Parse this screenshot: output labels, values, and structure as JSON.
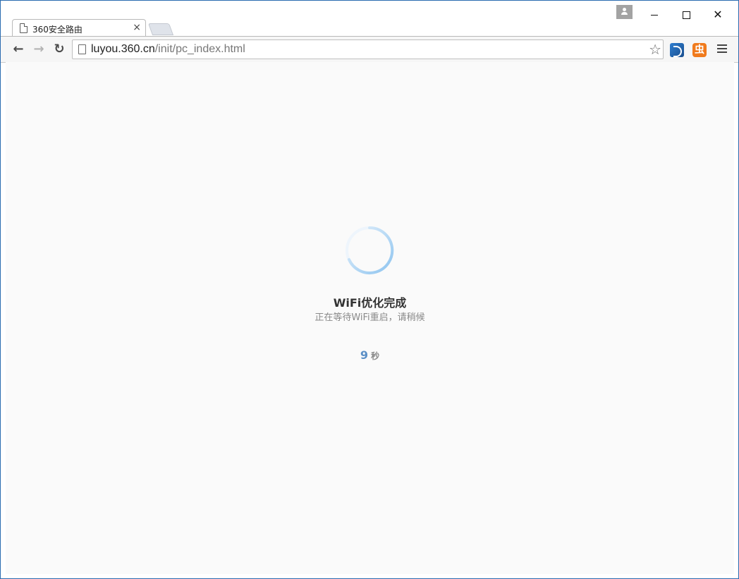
{
  "tab": {
    "title": "360安全路由",
    "close": "×"
  },
  "window_controls": {
    "close": "✕"
  },
  "toolbar": {
    "back": "←",
    "forward": "→",
    "reload": "↻",
    "url_host": "luyou.360.cn",
    "url_path": "/init/pc_index.html",
    "star": "☆",
    "ext2_label": "虫"
  },
  "page": {
    "title": "WiFi优化完成",
    "subtitle": "正在等待WiFi重启，请稍候",
    "countdown_value": "9",
    "countdown_unit": "秒"
  },
  "colors": {
    "spinner": "#8ec4ef",
    "countdown": "#5b8fc6",
    "ext_orange": "#f07a1c",
    "ext_blue": "#2e7ed0"
  }
}
